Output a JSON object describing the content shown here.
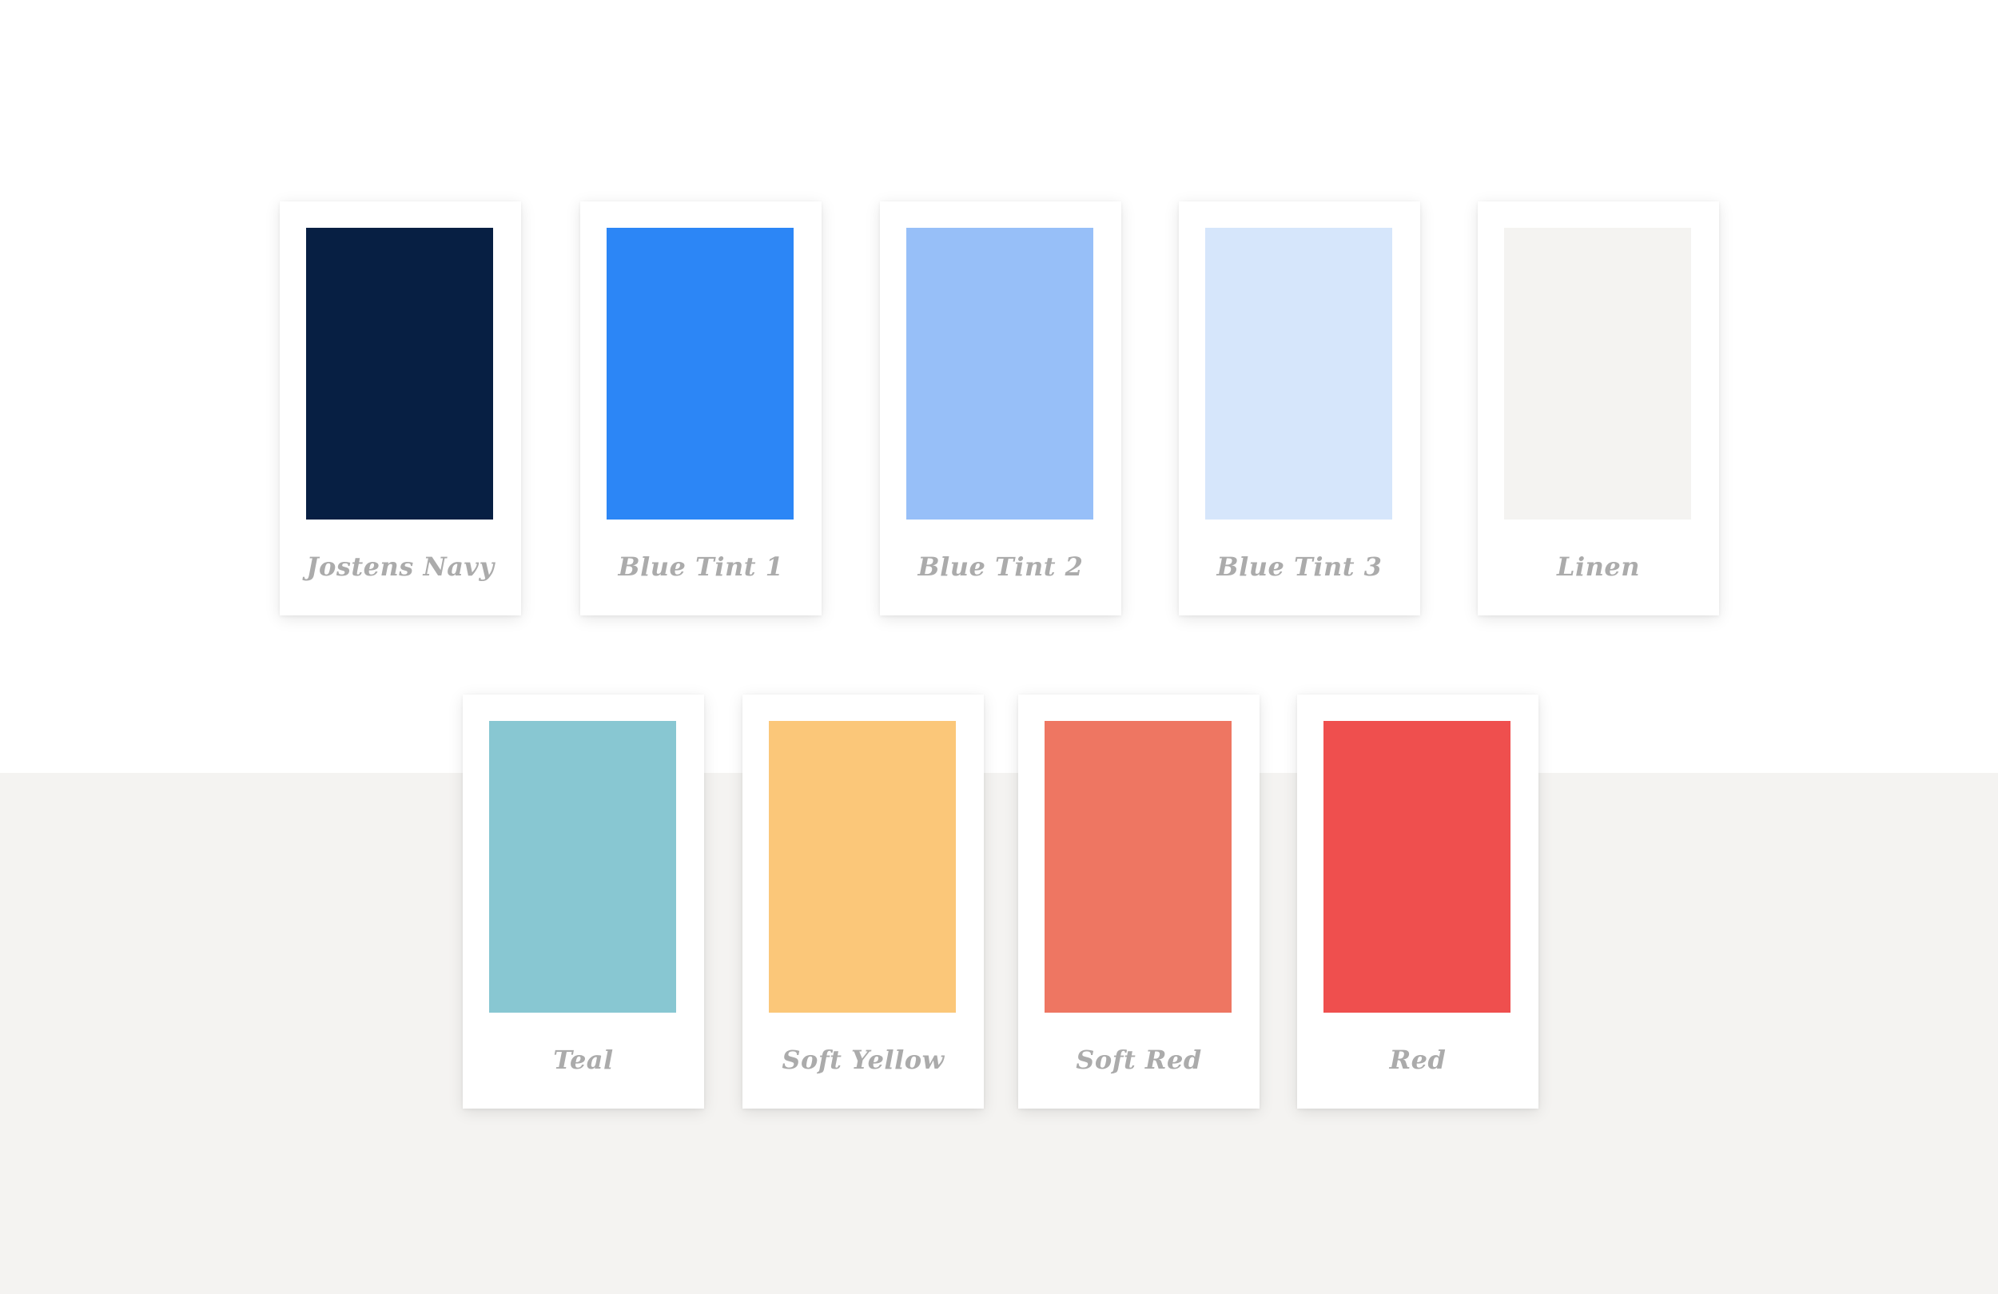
{
  "swatches": [
    {
      "label": "Jostens Navy",
      "color": "#071f43"
    },
    {
      "label": "Blue Tint 1",
      "color": "#2c86f6"
    },
    {
      "label": "Blue Tint 2",
      "color": "#97bff8"
    },
    {
      "label": "Blue Tint 3",
      "color": "#d6e6fb"
    },
    {
      "label": "Linen",
      "color": "#f4f3f1"
    },
    {
      "label": "Teal",
      "color": "#88c7d2"
    },
    {
      "label": "Soft Yellow",
      "color": "#fbc779"
    },
    {
      "label": "Soft Red",
      "color": "#ee7662"
    },
    {
      "label": "Red",
      "color": "#ef4f4e"
    }
  ],
  "background": {
    "top": "#ffffff",
    "bottom": "#f4f3f1"
  }
}
